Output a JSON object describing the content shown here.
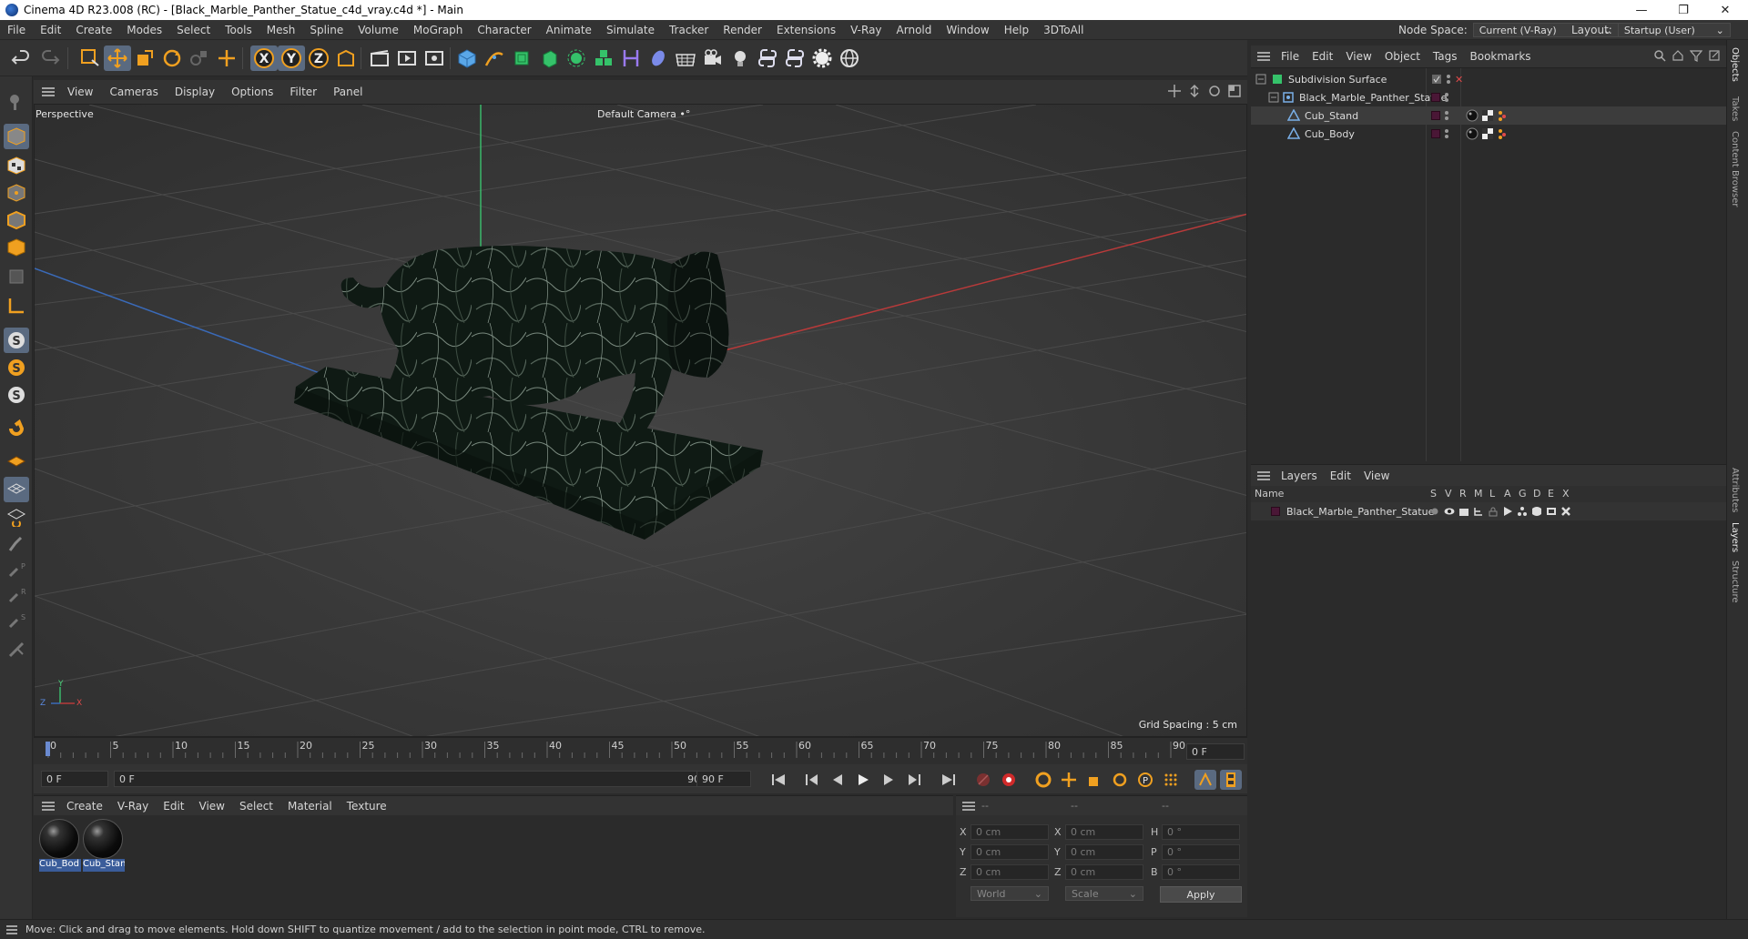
{
  "window": {
    "title": "Cinema 4D R23.008 (RC) - [Black_Marble_Panther_Statue_c4d_vray.c4d *] - Main",
    "controls": [
      "—",
      "❐",
      "✕"
    ]
  },
  "menubar": {
    "items": [
      "File",
      "Edit",
      "Create",
      "Modes",
      "Select",
      "Tools",
      "Mesh",
      "Spline",
      "Volume",
      "MoGraph",
      "Character",
      "Animate",
      "Simulate",
      "Tracker",
      "Render",
      "Extensions",
      "V-Ray",
      "Arnold",
      "Window",
      "Help",
      "3DToAll"
    ],
    "node_space_label": "Node Space:",
    "node_space_value": "Current (V-Ray)",
    "layout_label": "Layout:",
    "layout_value": "Startup (User)"
  },
  "viewport": {
    "menu": [
      "View",
      "Cameras",
      "Display",
      "Options",
      "Filter",
      "Panel"
    ],
    "label": "Perspective",
    "camera": "Default Camera",
    "camera_icon": "•°",
    "grid_spacing": "Grid Spacing : 5 cm",
    "axis_labels": {
      "x": "X",
      "y": "Y",
      "z": "Z"
    }
  },
  "timeline": {
    "ticks": [
      "0",
      "5",
      "10",
      "15",
      "20",
      "25",
      "30",
      "35",
      "40",
      "45",
      "50",
      "55",
      "60",
      "65",
      "70",
      "75",
      "80",
      "85",
      "90"
    ],
    "current_frame": "0 F",
    "start_field": "0 F",
    "range_start": "0 F",
    "range_end": "90 F",
    "end_field": "90 F"
  },
  "materials": {
    "menu": [
      "Create",
      "V-Ray",
      "Edit",
      "View",
      "Select",
      "Material",
      "Texture"
    ],
    "items": [
      "Cub_Bod",
      "Cub_Stan"
    ]
  },
  "coordinates": {
    "head_dashes": [
      "--",
      "--",
      "--"
    ],
    "rows": [
      {
        "a": "X",
        "av": "0 cm",
        "b": "X",
        "bv": "0 cm",
        "c": "H",
        "cv": "0 °"
      },
      {
        "a": "Y",
        "av": "0 cm",
        "b": "Y",
        "bv": "0 cm",
        "c": "P",
        "cv": "0 °"
      },
      {
        "a": "Z",
        "av": "0 cm",
        "b": "Z",
        "bv": "0 cm",
        "c": "B",
        "cv": "0 °"
      }
    ],
    "space": "World",
    "mode": "Scale",
    "apply": "Apply"
  },
  "objects": {
    "menu": [
      "File",
      "Edit",
      "View",
      "Object",
      "Tags",
      "Bookmarks"
    ],
    "rows": [
      {
        "name": "Subdivision Surface",
        "indent": 0
      },
      {
        "name": "Black_Marble_Panther_Statue",
        "indent": 1
      },
      {
        "name": "Cub_Stand",
        "indent": 2
      },
      {
        "name": "Cub_Body",
        "indent": 2
      }
    ]
  },
  "layers": {
    "menu": [
      "Layers",
      "Edit",
      "View"
    ],
    "name_header": "Name",
    "columns": [
      "S",
      "V",
      "R",
      "M",
      "L",
      "A",
      "G",
      "D",
      "E",
      "X"
    ],
    "rows": [
      {
        "name": "Black_Marble_Panther_Statue"
      }
    ]
  },
  "right_tabs": [
    "Objects",
    "Takes",
    "Content Browser",
    "Attributes",
    "Layers",
    "Structure"
  ],
  "status": "Move: Click and drag to move elements. Hold down SHIFT to quantize movement / add to the selection in point mode, CTRL to remove.",
  "colors": {
    "accent": "#5a6a80",
    "layer_color": "#4a1736",
    "selection": "#3a5c9a"
  }
}
